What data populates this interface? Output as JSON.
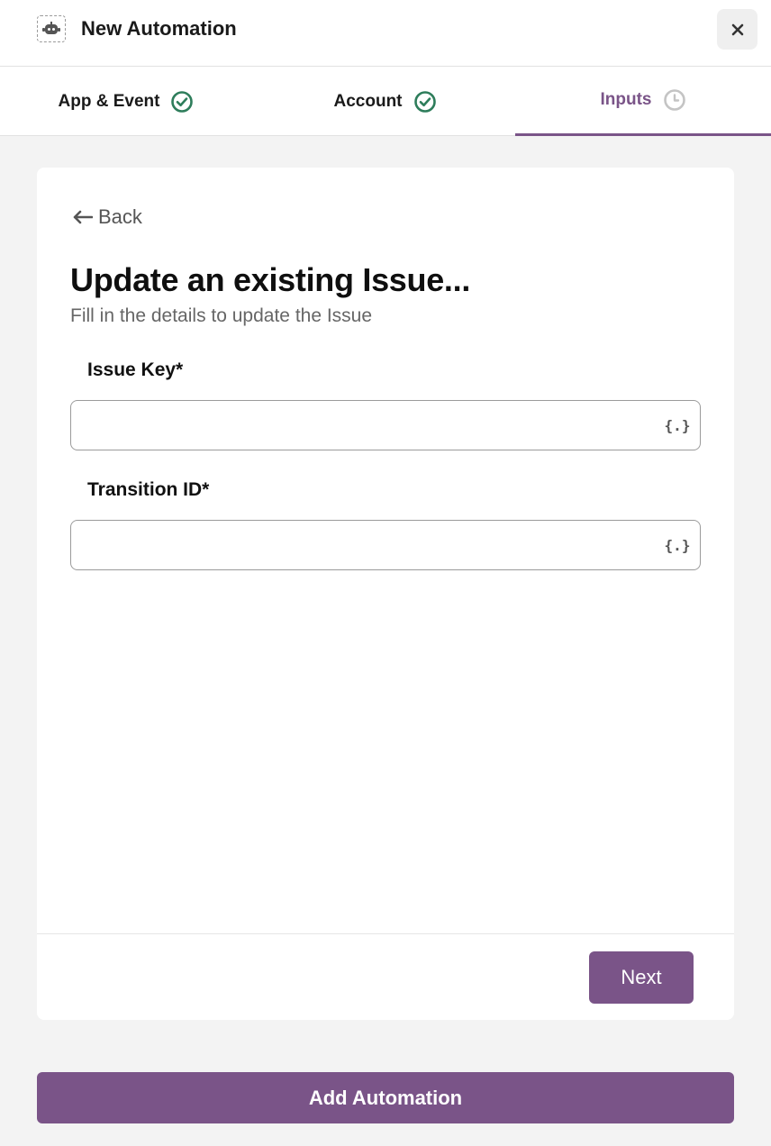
{
  "header": {
    "title": "New Automation",
    "app_icon": "robot-icon",
    "close_icon": "close-icon"
  },
  "tabs": [
    {
      "label": "App & Event",
      "status": "complete",
      "icon": "check-circle-icon"
    },
    {
      "label": "Account",
      "status": "complete",
      "icon": "check-circle-icon"
    },
    {
      "label": "Inputs",
      "status": "active",
      "icon": "clock-icon"
    }
  ],
  "form": {
    "back_label": "Back",
    "title": "Update an existing Issue...",
    "subtitle": "Fill in the details to update the Issue",
    "fields": [
      {
        "label": "Issue Key*",
        "value": "",
        "variable_button": "{.}"
      },
      {
        "label": "Transition ID*",
        "value": "",
        "variable_button": "{.}"
      }
    ],
    "next_label": "Next"
  },
  "footer": {
    "add_label": "Add Automation"
  },
  "colors": {
    "accent": "#7a5488",
    "success": "#2e7d5b",
    "background": "#f3f3f3"
  }
}
